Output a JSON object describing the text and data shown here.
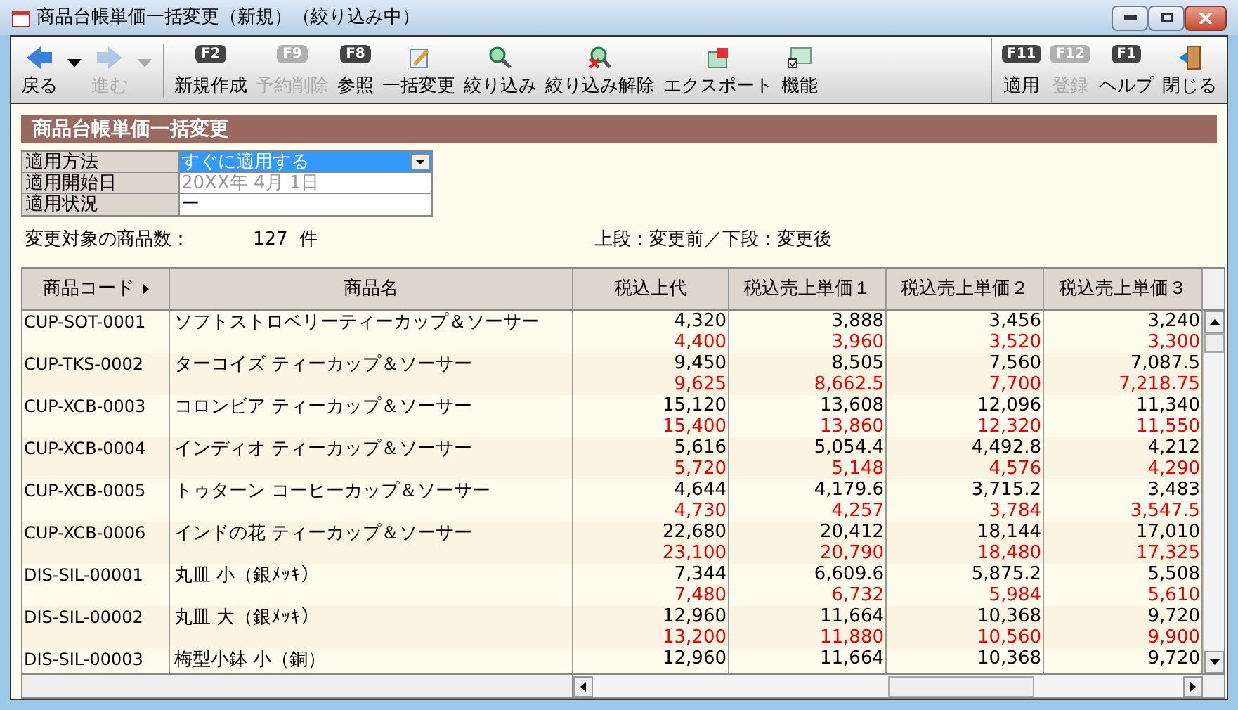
{
  "window": {
    "title": "商品台帳単価一括変更（新規）（絞り込み中）"
  },
  "toolbar": {
    "nav": [
      {
        "label": "戻る",
        "kind": "back",
        "disabled": false
      },
      {
        "label": "進む",
        "kind": "forward",
        "disabled": true
      }
    ],
    "main": [
      {
        "label": "新規作成",
        "kind": "fkey",
        "key": "F2",
        "disabled": false
      },
      {
        "label": "予約削除",
        "kind": "fkey",
        "key": "F9",
        "disabled": true
      },
      {
        "label": "参照",
        "kind": "fkey",
        "key": "F8",
        "disabled": false
      },
      {
        "label": "一括変更",
        "kind": "batch",
        "disabled": false
      },
      {
        "label": "絞り込み",
        "kind": "filter",
        "disabled": false
      },
      {
        "label": "絞り込み解除",
        "kind": "unfilter",
        "disabled": false
      },
      {
        "label": "エクスポート",
        "kind": "export",
        "disabled": false
      },
      {
        "label": "機能",
        "kind": "function",
        "disabled": false
      }
    ],
    "right": [
      {
        "label": "適用",
        "kind": "fkey",
        "key": "F11",
        "disabled": false
      },
      {
        "label": "登録",
        "kind": "fkey",
        "key": "F12",
        "disabled": true
      },
      {
        "label": "ヘルプ",
        "kind": "fkey",
        "key": "F1",
        "disabled": false
      },
      {
        "label": "閉じる",
        "kind": "close",
        "disabled": false
      }
    ]
  },
  "panel": {
    "title": "商品台帳単価一括変更"
  },
  "form": [
    {
      "label": "適用方法",
      "value": "すぐに適用する",
      "kind": "select"
    },
    {
      "label": "適用開始日",
      "value": "20XX年 4月 1日",
      "kind": "disabled"
    },
    {
      "label": "適用状況",
      "value": "ー",
      "kind": "text"
    }
  ],
  "summary": {
    "label": "変更対象の商品数：",
    "count": "127",
    "unit": "件",
    "legend": "上段：変更前／下段：変更後"
  },
  "table": {
    "columns": [
      "商品コード",
      "商品名",
      "税込上代",
      "税込売上単価１",
      "税込売上単価２",
      "税込売上単価３"
    ],
    "rows": [
      {
        "code": "CUP-SOT-0001",
        "name": "ソフトストロベリーティーカップ＆ソーサー",
        "before": [
          "4,320",
          "3,888",
          "3,456",
          "3,240"
        ],
        "after": [
          "4,400",
          "3,960",
          "3,520",
          "3,300"
        ]
      },
      {
        "code": "CUP-TKS-0002",
        "name": "ターコイズ ティーカップ＆ソーサー",
        "before": [
          "9,450",
          "8,505",
          "7,560",
          "7,087.5"
        ],
        "after": [
          "9,625",
          "8,662.5",
          "7,700",
          "7,218.75"
        ]
      },
      {
        "code": "CUP-XCB-0003",
        "name": "コロンビア ティーカップ＆ソーサー",
        "before": [
          "15,120",
          "13,608",
          "12,096",
          "11,340"
        ],
        "after": [
          "15,400",
          "13,860",
          "12,320",
          "11,550"
        ]
      },
      {
        "code": "CUP-XCB-0004",
        "name": "インディオ ティーカップ＆ソーサー",
        "before": [
          "5,616",
          "5,054.4",
          "4,492.8",
          "4,212"
        ],
        "after": [
          "5,720",
          "5,148",
          "4,576",
          "4,290"
        ]
      },
      {
        "code": "CUP-XCB-0005",
        "name": "トゥターン コーヒーカップ＆ソーサー",
        "before": [
          "4,644",
          "4,179.6",
          "3,715.2",
          "3,483"
        ],
        "after": [
          "4,730",
          "4,257",
          "3,784",
          "3,547.5"
        ]
      },
      {
        "code": "CUP-XCB-0006",
        "name": "インドの花 ティーカップ＆ソーサー",
        "before": [
          "22,680",
          "20,412",
          "18,144",
          "17,010"
        ],
        "after": [
          "23,100",
          "20,790",
          "18,480",
          "17,325"
        ]
      },
      {
        "code": "DIS-SIL-00001",
        "name": "丸皿 小（銀ﾒｯｷ）",
        "before": [
          "7,344",
          "6,609.6",
          "5,875.2",
          "5,508"
        ],
        "after": [
          "7,480",
          "6,732",
          "5,984",
          "5,610"
        ]
      },
      {
        "code": "DIS-SIL-00002",
        "name": "丸皿 大（銀ﾒｯｷ）",
        "before": [
          "12,960",
          "11,664",
          "10,368",
          "9,720"
        ],
        "after": [
          "13,200",
          "11,880",
          "10,560",
          "9,900"
        ]
      },
      {
        "code": "DIS-SIL-00003",
        "name": "梅型小鉢 小（銅）",
        "before": [
          "12,960",
          "11,664",
          "10,368",
          "9,720"
        ]
      }
    ]
  }
}
